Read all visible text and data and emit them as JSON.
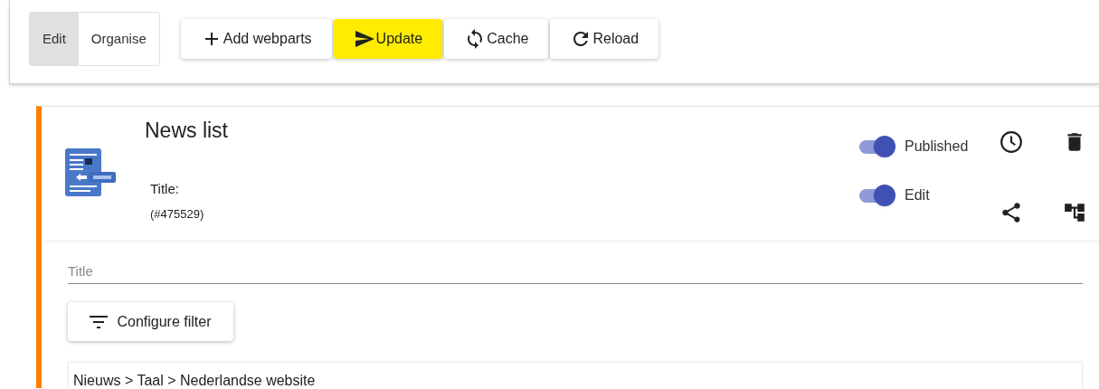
{
  "mode_toggle": [
    {
      "label": "Edit",
      "selected": true
    },
    {
      "label": "Organise",
      "selected": false
    }
  ],
  "toolbar": [
    {
      "kind": "add",
      "label": "Add webparts",
      "highlighted": false
    },
    {
      "kind": "send",
      "label": "Update",
      "highlighted": true
    },
    {
      "kind": "sync",
      "label": "Cache",
      "highlighted": false
    },
    {
      "kind": "reload",
      "label": "Reload",
      "highlighted": false
    }
  ],
  "webpart": {
    "title": "News list",
    "subtitle": "Title:",
    "id": "(#475529)",
    "toggles": [
      {
        "label": "Published",
        "on": true
      },
      {
        "label": "Edit",
        "on": true
      }
    ],
    "title_field": {
      "placeholder": "Title"
    },
    "filter_button": "Configure filter",
    "breadcrumb": "Nieuws > Taal > Nederlandse website"
  }
}
